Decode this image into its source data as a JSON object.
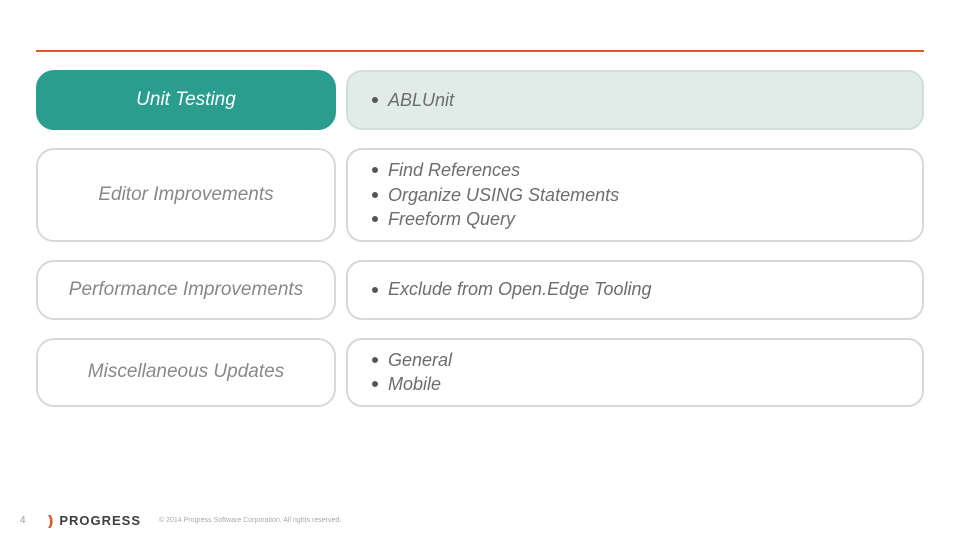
{
  "page_number": "4",
  "logo_text": "PROGRESS",
  "copyright": "© 2014 Progress Software Corporation. All rights reserved.",
  "rows": [
    {
      "category": "Unit Testing",
      "active": true,
      "items": [
        "ABLUnit"
      ]
    },
    {
      "category": "Editor Improvements",
      "active": false,
      "items": [
        "Find References",
        "Organize USING Statements",
        "Freeform Query"
      ]
    },
    {
      "category": "Performance Improvements",
      "active": false,
      "items": [
        "Exclude from Open.Edge Tooling"
      ]
    },
    {
      "category": "Miscellaneous Updates",
      "active": false,
      "items": [
        "General",
        "Mobile"
      ]
    }
  ]
}
